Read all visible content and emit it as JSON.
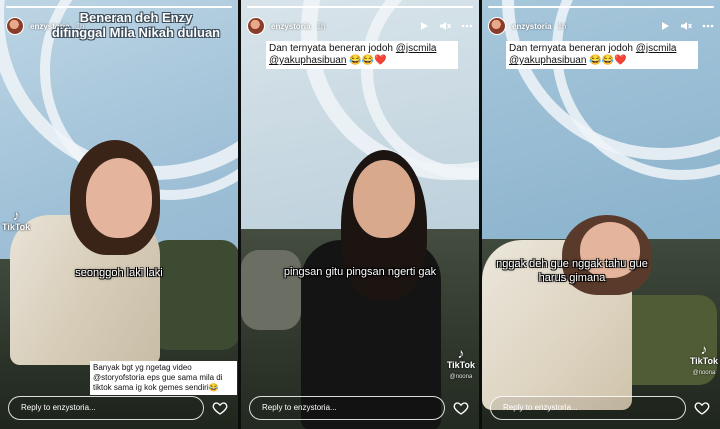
{
  "panels": [
    {
      "username": "enzystoria",
      "time": "1h",
      "overlay_title": "Beneran deh Enzy\ndifinggal Mila Nikah duluan",
      "caption": "seonggoh laki laki",
      "tiktok_label": "TikTok",
      "text_box": "Banyak bgt yg ngetag video @storyofstoria eps gue sama mila di tiktok sama ig kok gemes sendiri😂",
      "reply_placeholder": "Reply to enzystoria..."
    },
    {
      "username": "enzystoria",
      "time": "1h",
      "text_box_prefix": "Dan ternyata beneran jodoh ",
      "mention_1": "@jscmila",
      "mention_2": "@yakuphasibuan",
      "emoji": "😂😂❤️",
      "caption": "pingsan gitu pingsan ngerti gak",
      "tiktok_label": "TikTok",
      "tiktok_handle": "@noona",
      "reply_placeholder": "Reply to enzystoria..."
    },
    {
      "username": "enzystoria",
      "time": "1h",
      "text_box_prefix": "Dan ternyata beneran jodoh ",
      "mention_1": "@jscmila",
      "mention_2": "@yakuphasibuan",
      "emoji": "😂😂❤️",
      "caption": "nggak deh gue nggak tahu gue harus gimana",
      "tiktok_label": "TikTok",
      "tiktok_handle": "@noona",
      "reply_placeholder": "Reply to enzystoria..."
    }
  ],
  "icons": {
    "play": "play-icon",
    "mute": "mute-icon",
    "more": "more-icon",
    "like": "heart-icon",
    "tiktok": "tiktok-logo"
  }
}
